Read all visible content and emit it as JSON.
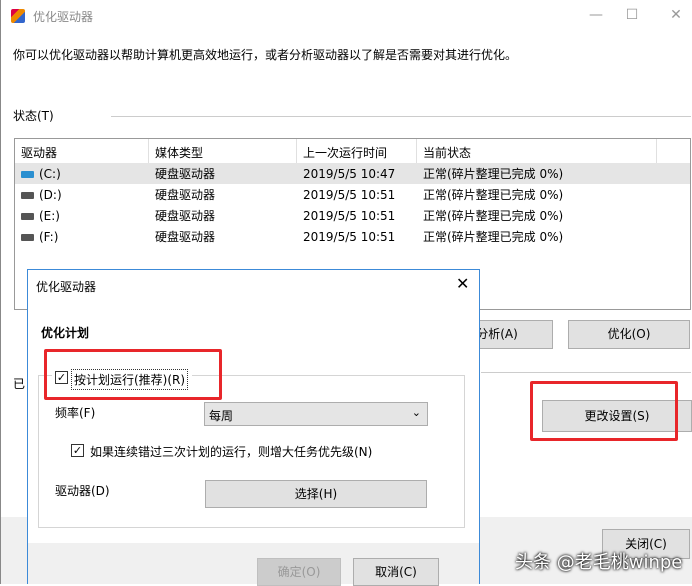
{
  "window": {
    "title": "优化驱动器",
    "minimize": "—",
    "maximize": "☐",
    "close": "✕"
  },
  "description": "你可以优化驱动器以帮助计算机更高效地运行，或者分析驱动器以了解是否需要对其进行优化。",
  "status_label": "状态(T)",
  "table": {
    "headers": [
      "驱动器",
      "媒体类型",
      "上一次运行时间",
      "当前状态"
    ],
    "rows": [
      {
        "drive": "(C:)",
        "media": "硬盘驱动器",
        "last_run": "2019/5/5 10:47",
        "status": "正常(碎片整理已完成 0%)"
      },
      {
        "drive": "(D:)",
        "media": "硬盘驱动器",
        "last_run": "2019/5/5 10:51",
        "status": "正常(碎片整理已完成 0%)"
      },
      {
        "drive": "(E:)",
        "media": "硬盘驱动器",
        "last_run": "2019/5/5 10:51",
        "status": "正常(碎片整理已完成 0%)"
      },
      {
        "drive": "(F:)",
        "media": "硬盘驱动器",
        "last_run": "2019/5/5 10:51",
        "status": "正常(碎片整理已完成 0%)"
      }
    ]
  },
  "buttons": {
    "analyze": "分析(A)",
    "optimize": "优化(O)",
    "change_settings": "更改设置(S)",
    "close": "关闭(C)"
  },
  "partial_label": "已",
  "dialog": {
    "title": "优化驱动器",
    "close": "✕",
    "section": "优化计划",
    "run_on_schedule": "按计划运行(推荐)(R)",
    "frequency_label": "频率(F)",
    "frequency_value": "每周",
    "increase_priority": "如果连续错过三次计划的运行，则增大任务优先级(N)",
    "drives_label": "驱动器(D)",
    "choose": "选择(H)",
    "ok": "确定(O)",
    "cancel": "取消(C)"
  },
  "watermark": "头条 @老毛桃winpe"
}
